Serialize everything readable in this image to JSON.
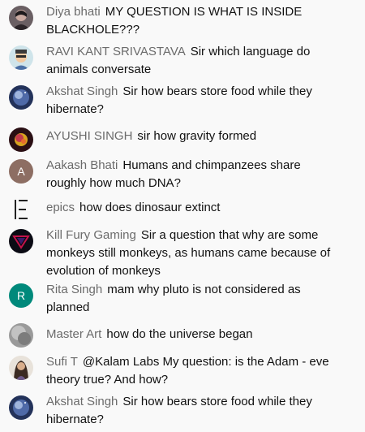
{
  "messages": [
    {
      "author": "Diya bhati",
      "text": "MY QUESTION IS WHAT IS INSIDE BLACKHOLE???",
      "avatar": "photo-icon"
    },
    {
      "author": "RAVI KANT SRIVASTAVA",
      "text": "Sir which language do animals conversate",
      "avatar": "cartoon-icon"
    },
    {
      "author": "Akshat Singh",
      "text": "Sir how bears store food while they hibernate?",
      "avatar": "space-icon"
    },
    {
      "author": "AYUSHI SINGH",
      "text": "sir how gravity formed",
      "avatar": "flower-icon"
    },
    {
      "author": "Aakash Bhati",
      "text": "Humans and chimpanzees share roughly how much DNA?",
      "avatar": "letter-icon",
      "initial": "A"
    },
    {
      "author": "epics",
      "text": "how does dinosaur extinct",
      "avatar": "logo-icon"
    },
    {
      "author": "Kill Fury Gaming",
      "text": "Sir a question that why are some monkeys still monkeys, as humans came because of evolution of monkeys",
      "avatar": "triangle-icon"
    },
    {
      "author": "Rita Singh",
      "text": "mam why pluto is not considered as planned",
      "avatar": "letter-icon",
      "initial": "R"
    },
    {
      "author": "Master Art",
      "text": "how do the universe began",
      "avatar": "gray-photo-icon"
    },
    {
      "author": "Sufi T",
      "text": "@Kalam Labs My question: is the Adam - eve theory true? And how?",
      "avatar": "portrait-icon"
    },
    {
      "author": "Akshat Singh",
      "text": "Sir how bears store food while they hibernate?",
      "avatar": "space-icon"
    }
  ],
  "colors": {
    "author": "#6b6b6b",
    "text": "#111111",
    "background": "#f9f9f9",
    "avatar_a": "#8d6e63",
    "avatar_r": "#00897b"
  }
}
